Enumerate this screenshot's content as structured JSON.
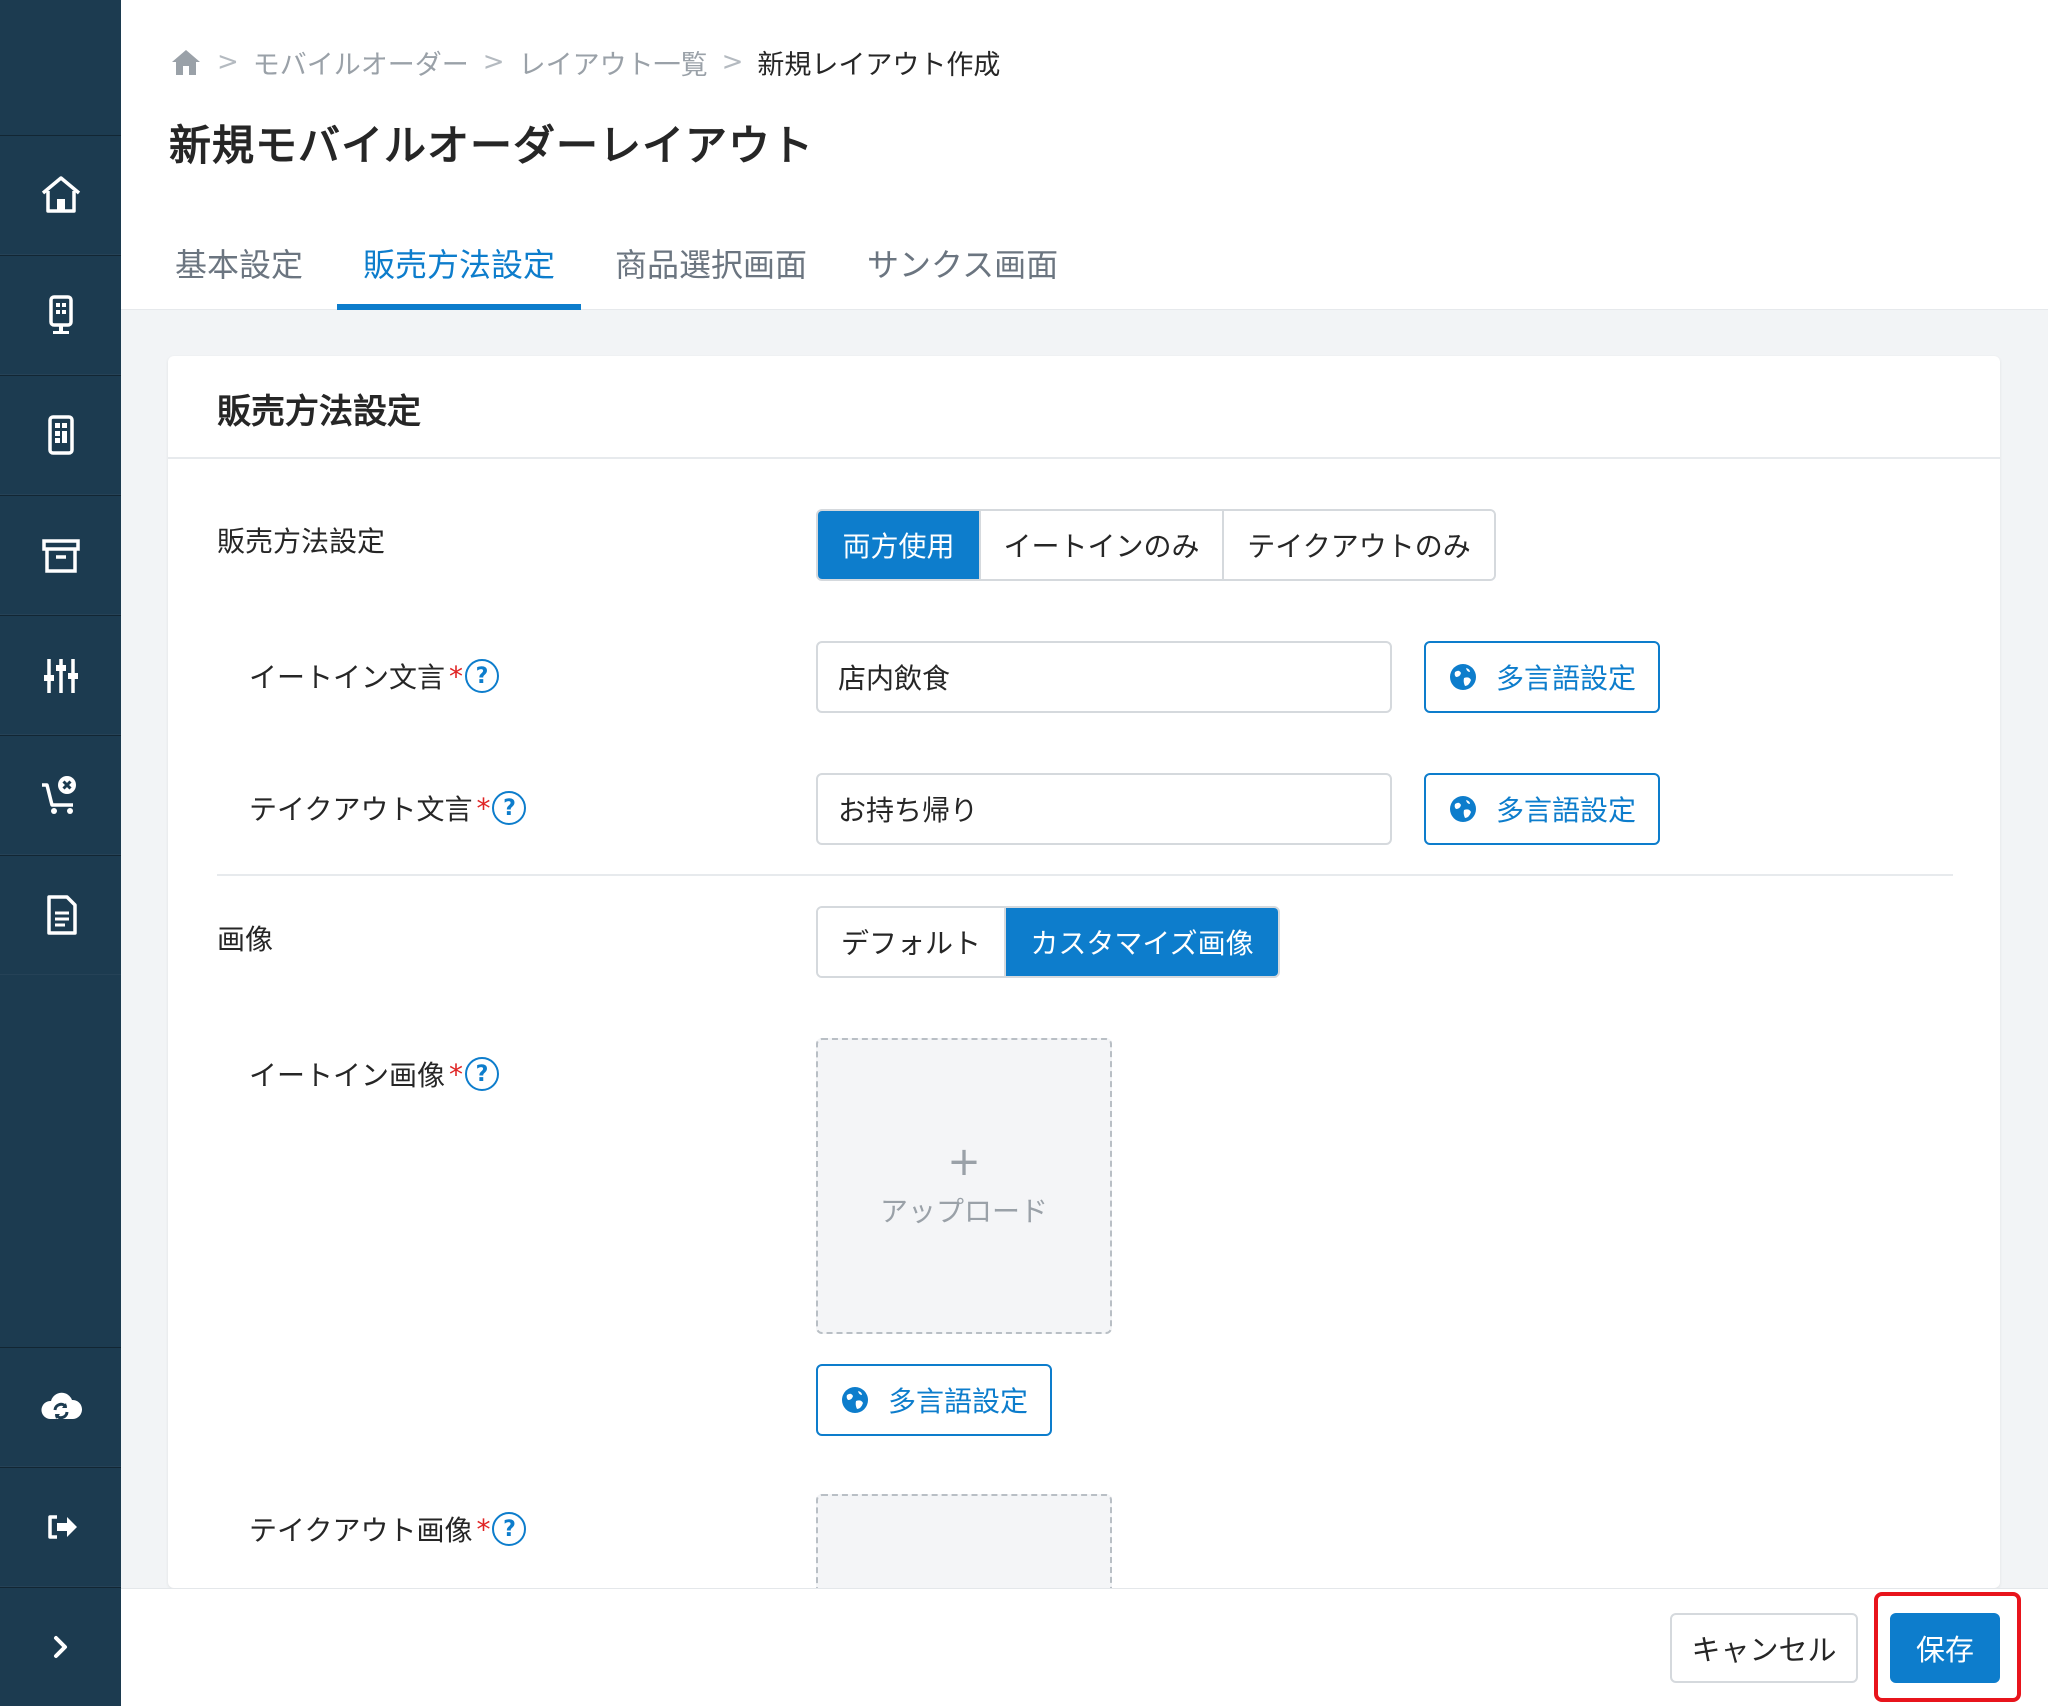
{
  "sidebar": {
    "items": [
      {
        "icon": "home-icon"
      },
      {
        "icon": "kiosk-icon"
      },
      {
        "icon": "mobile-layout-icon"
      },
      {
        "icon": "archive-box-icon"
      },
      {
        "icon": "sliders-icon"
      },
      {
        "icon": "cart-cancel-icon"
      },
      {
        "icon": "document-icon"
      },
      {
        "icon": "cloud-sync-icon"
      },
      {
        "icon": "logout-icon"
      },
      {
        "icon": "chevron-right-icon"
      }
    ]
  },
  "breadcrumb": {
    "items": [
      "モバイルオーダー",
      "レイアウト一覧"
    ],
    "current": "新規レイアウト作成",
    "separator": ">"
  },
  "page": {
    "title": "新規モバイルオーダーレイアウト"
  },
  "tabs": [
    {
      "label": "基本設定",
      "active": false
    },
    {
      "label": "販売方法設定",
      "active": true
    },
    {
      "label": "商品選択画面",
      "active": false
    },
    {
      "label": "サンクス画面",
      "active": false
    }
  ],
  "card": {
    "title": "販売方法設定",
    "sales_method": {
      "label": "販売方法設定",
      "options": [
        "両方使用",
        "イートインのみ",
        "テイクアウトのみ"
      ],
      "selected": "両方使用"
    },
    "eatin_text": {
      "label": "イートイン文言",
      "required_mark": "*",
      "help": "?",
      "value": "店内飲食",
      "multilang_label": "多言語設定"
    },
    "takeout_text": {
      "label": "テイクアウト文言",
      "required_mark": "*",
      "help": "?",
      "value": "お持ち帰り",
      "multilang_label": "多言語設定"
    },
    "image": {
      "label": "画像",
      "options": [
        "デフォルト",
        "カスタマイズ画像"
      ],
      "selected": "カスタマイズ画像"
    },
    "eatin_image": {
      "label": "イートイン画像",
      "required_mark": "*",
      "help": "?",
      "upload_plus": "+",
      "upload_label": "アップロード",
      "multilang_label": "多言語設定"
    },
    "takeout_image": {
      "label": "テイクアウト画像",
      "required_mark": "*",
      "help": "?"
    }
  },
  "footer": {
    "cancel_label": "キャンセル",
    "save_label": "保存"
  },
  "colors": {
    "sidebar_bg": "#1c3b50",
    "accent": "#0d7dcc",
    "required": "#e02424",
    "highlight": "#e8141c"
  }
}
